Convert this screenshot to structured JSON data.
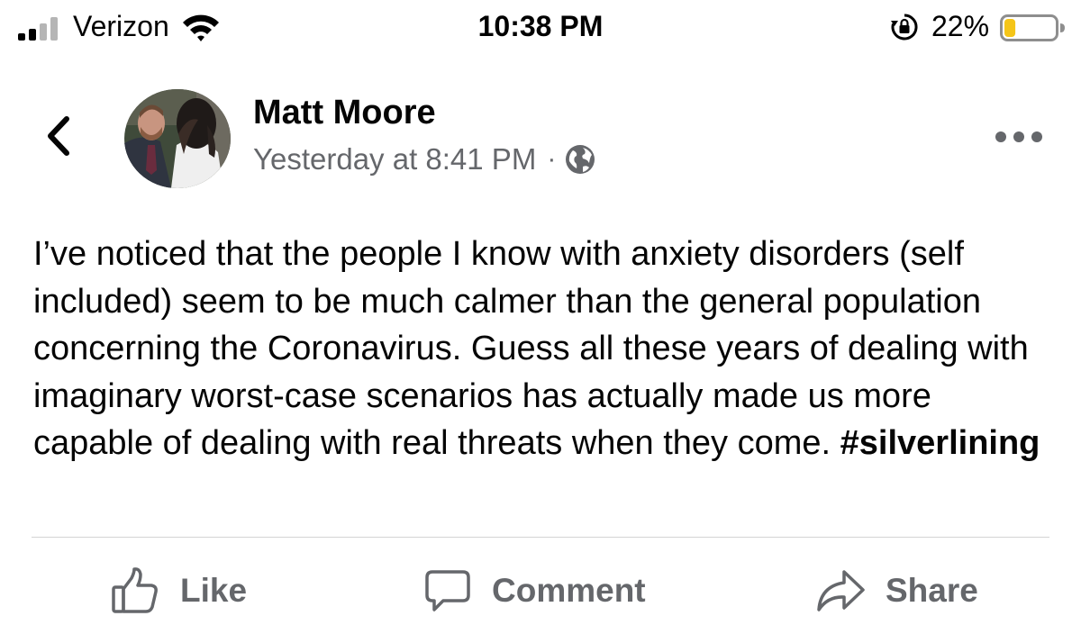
{
  "status_bar": {
    "carrier": "Verizon",
    "time": "10:38 PM",
    "battery_percent": "22%",
    "battery_level": 0.22,
    "signal_bars": 2
  },
  "post": {
    "author_name": "Matt Moore",
    "timestamp": "Yesterday at 8:41 PM",
    "separator": "·",
    "audience_icon": "globe-icon",
    "body_text": "I’ve noticed that the people I know with anxiety disorders (self included) seem to be much calmer than the general population concerning the Coronavirus. Guess all these years of dealing with imaginary worst-case scenarios has actually made us more capable of dealing with real threats when they come. ",
    "hashtag": "#silverlining"
  },
  "actions": {
    "like_label": "Like",
    "comment_label": "Comment",
    "share_label": "Share"
  },
  "colors": {
    "secondary_text": "#65676b",
    "primary_text": "#050505",
    "battery_low": "#f5c518"
  }
}
